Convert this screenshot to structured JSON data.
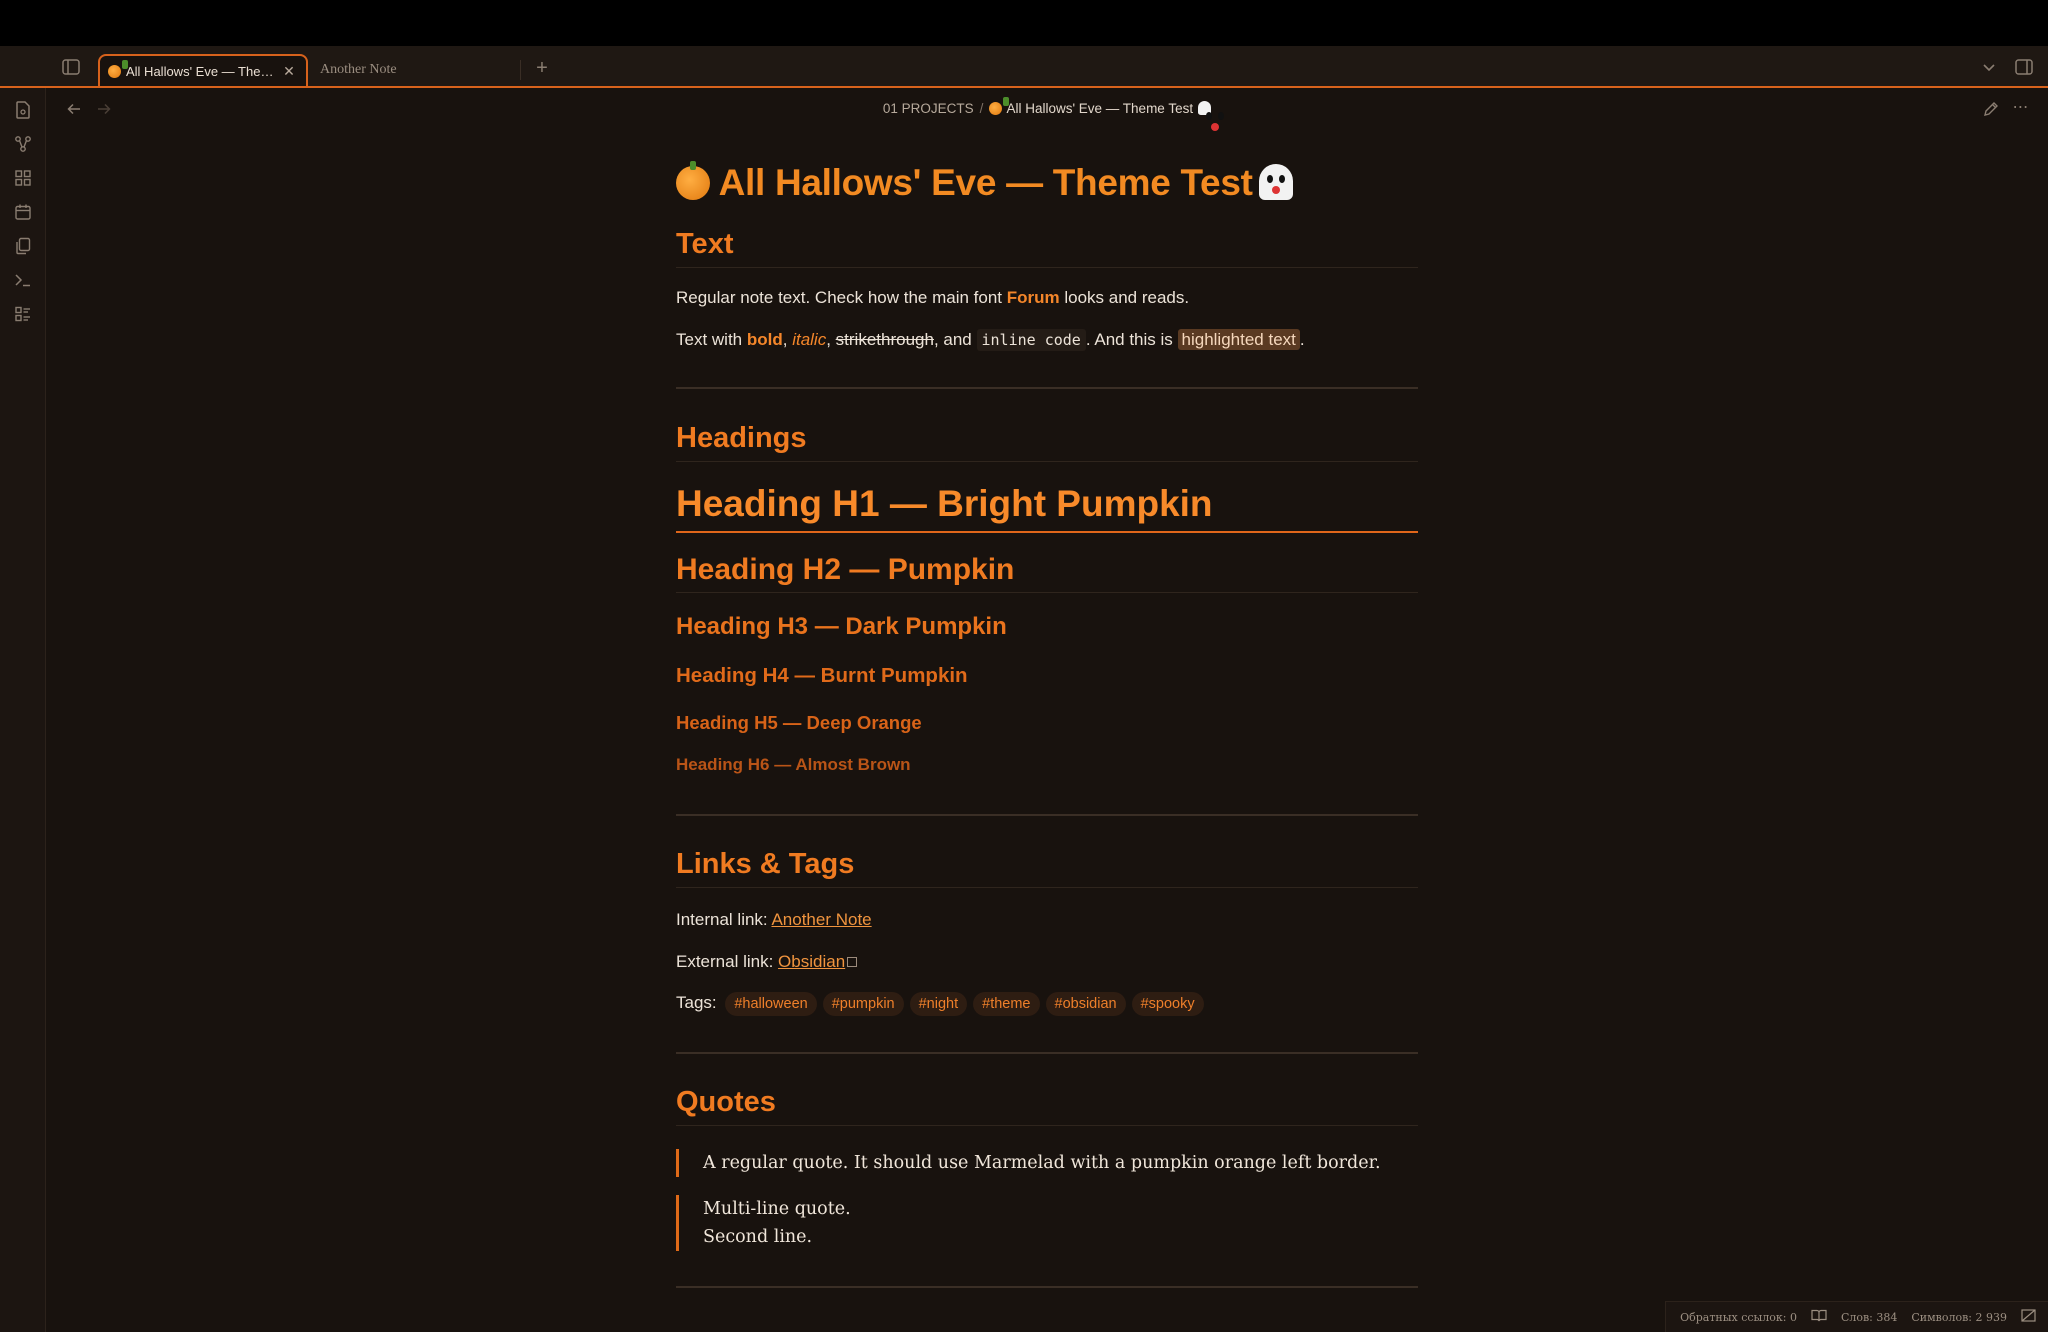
{
  "tabs": [
    {
      "label": "All Hallows' Eve — Theme..."
    },
    {
      "label": "Another Note"
    }
  ],
  "breadcrumb": {
    "folder": "01 PROJECTS",
    "separator": "/",
    "title": "All Hallows' Eve — Theme Test"
  },
  "doc": {
    "title": "All Hallows' Eve — Theme Test",
    "text_heading": "Text",
    "text_p1_a": "Regular note text. Check how the main font ",
    "text_p1_font": "Forum",
    "text_p1_b": " looks and reads.",
    "text_p2_a": "Text with ",
    "bold": "bold",
    "comma1": ", ",
    "italic": "italic",
    "comma2": ", ",
    "strike": "strikethrough",
    "and": ", and ",
    "code": "inline code",
    "text_p2_b": ". And this is ",
    "highlight": "highlighted text",
    "period": ".",
    "headings_heading": "Headings",
    "h1": "Heading H1 — Bright Pumpkin",
    "h2": "Heading H2 — Pumpkin",
    "h3": "Heading H3 — Dark Pumpkin",
    "h4": "Heading H4 — Burnt Pumpkin",
    "h5": "Heading H5 — Deep Orange",
    "h6": "Heading H6 — Almost Brown",
    "links_heading": "Links & Tags",
    "internal_label": "Internal link: ",
    "internal_link": "Another Note",
    "external_label": "External link: ",
    "external_link": "Obsidian",
    "tags_label": "Tags: ",
    "tags": [
      "#halloween",
      "#pumpkin",
      "#night",
      "#theme",
      "#obsidian",
      "#spooky"
    ],
    "quotes_heading": "Quotes",
    "quote1": "A regular quote. It should use Marmelad with a pumpkin orange left border.",
    "quote2_l1": "Multi-line quote.",
    "quote2_l2": "Second line."
  },
  "status": {
    "backlinks": "Обратных ссылок: 0",
    "words": "Слов: 384",
    "chars": "Символов: 2 939"
  },
  "colors": {
    "accent": "#f07b21",
    "background": "#18120e"
  }
}
